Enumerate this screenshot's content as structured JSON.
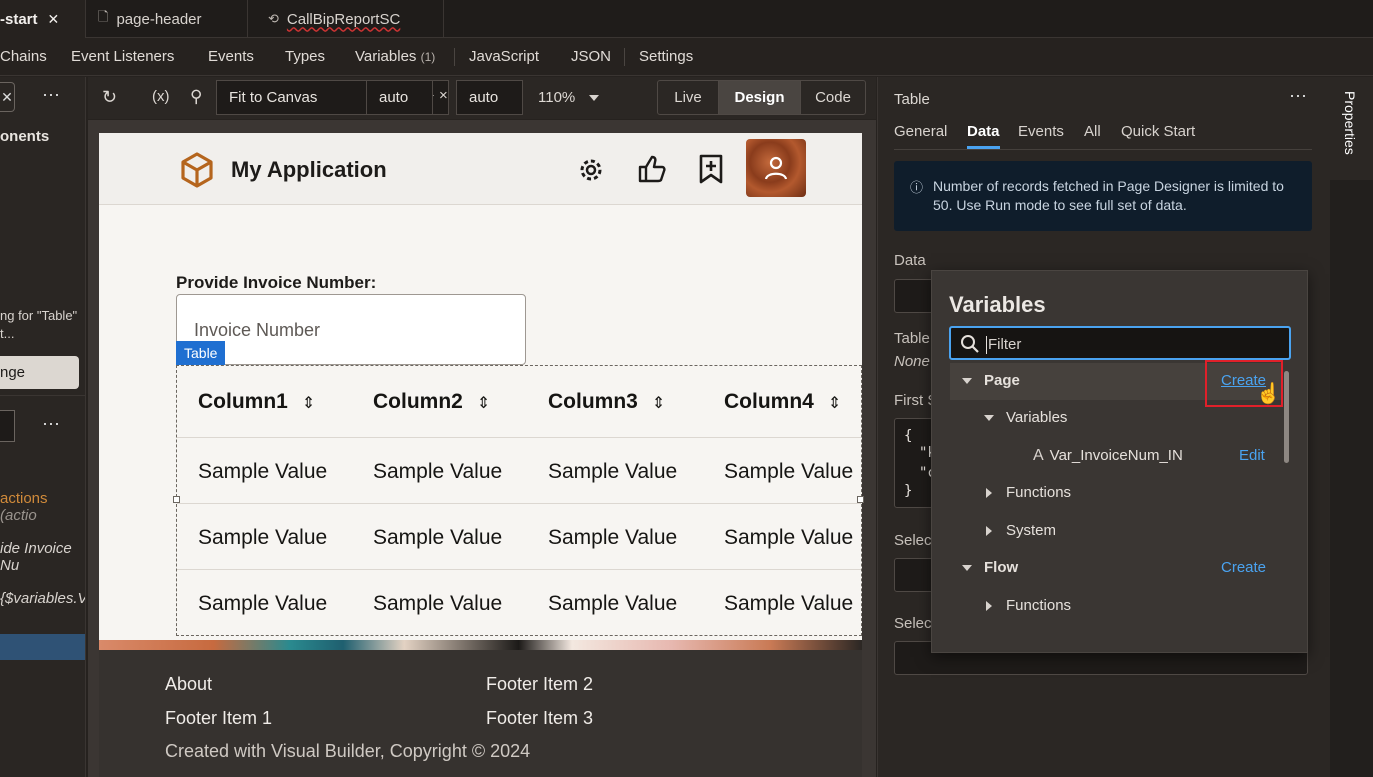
{
  "tabs": [
    {
      "label": "-start",
      "close": "✕"
    },
    {
      "label": "page-header"
    },
    {
      "label": "CallBipReportSC"
    }
  ],
  "menu": {
    "items": [
      "Chains",
      "Event Listeners",
      "Events",
      "Types",
      "Variables",
      "JavaScript",
      "JSON",
      "Settings"
    ],
    "variables_count": "(1)"
  },
  "left": {
    "components_label": "onents",
    "hint_line1": "ng for \"Table\"",
    "hint_line2": "t...",
    "change_label": "nge",
    "actions_label": "actions",
    "actions_suffix": "(actio",
    "item1": "ide Invoice Nu",
    "item2": "{$variables.V"
  },
  "toolbar": {
    "fit_label": "Fit to Canvas",
    "width_value": "auto",
    "height_value": "auto",
    "times": "×",
    "zoom": "110%",
    "modes": [
      "Live",
      "Design",
      "Code"
    ],
    "active_mode": "Design"
  },
  "app": {
    "title": "My Application",
    "invoice_label": "Provide Invoice Number:",
    "invoice_placeholder": "Invoice Number",
    "table_badge": "Table",
    "columns": [
      "Column1",
      "Column2",
      "Column3",
      "Column4"
    ],
    "rows": [
      [
        "Sample Value",
        "Sample Value",
        "Sample Value",
        "Sample Value"
      ],
      [
        "Sample Value",
        "Sample Value",
        "Sample Value",
        "Sample Value"
      ],
      [
        "Sample Value",
        "Sample Value",
        "Sample Value",
        "Sample Value"
      ]
    ],
    "footer": {
      "about": "About",
      "item1": "Footer Item 1",
      "item2": "Footer Item 2",
      "item3": "Footer Item 3",
      "copyright": "Created with Visual Builder, Copyright © 2024"
    }
  },
  "properties": {
    "title": "Table",
    "tabs": [
      "General",
      "Data",
      "Events",
      "All",
      "Quick Start"
    ],
    "active_tab": "Data",
    "info": "Number of records fetched in Page Designer is limited to 50. Use Run mode to see full set of data.",
    "data_label": "Data",
    "table_label": "Table",
    "none_value": "None",
    "first_label": "First S",
    "select_label1": "Selec",
    "select_label2": "Selec",
    "code_brace_open": "{",
    "code_line1": "\"k",
    "code_line2": "\"c",
    "code_brace_close": "}",
    "rail_label": "Properties"
  },
  "variables_popup": {
    "title": "Variables",
    "filter_placeholder": "Filter",
    "page_label": "Page",
    "create_label": "Create",
    "variables_label": "Variables",
    "var_name": "Var_InvoiceNum_IN",
    "edit_label": "Edit",
    "functions_label": "Functions",
    "system_label": "System",
    "flow_label": "Flow",
    "flow_create_label": "Create",
    "flow_functions_label": "Functions"
  },
  "colors": {
    "accent_blue": "#4aa3f0",
    "badge_blue": "#1f6fd1",
    "highlight_red": "#e0202a",
    "app_icon": "#b5651d"
  }
}
